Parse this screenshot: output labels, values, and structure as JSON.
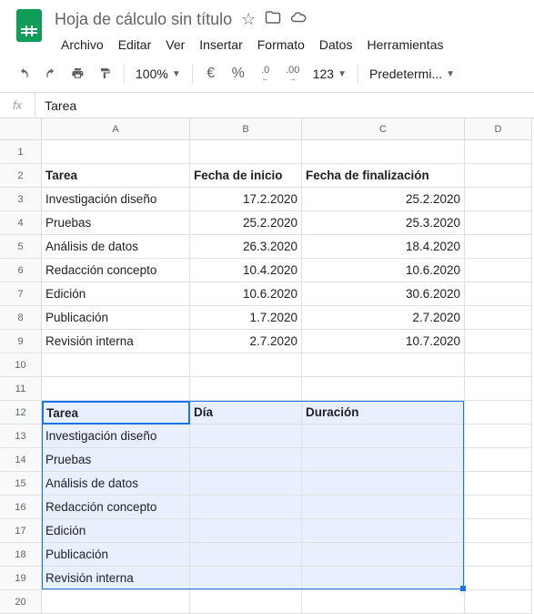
{
  "header": {
    "title": "Hoja de cálculo sin título",
    "menu": [
      "Archivo",
      "Editar",
      "Ver",
      "Insertar",
      "Formato",
      "Datos",
      "Herramientas"
    ]
  },
  "toolbar": {
    "zoom": "100%",
    "currency": "€",
    "percent": "%",
    "dec_dec": ".0",
    "dec_inc": ".00",
    "format": "123",
    "font": "Predetermi..."
  },
  "formula_bar": {
    "fx": "fx",
    "value": "Tarea"
  },
  "columns": [
    "A",
    "B",
    "C",
    "D"
  ],
  "row_count": 20,
  "active_cell": {
    "row": 12,
    "col": "A"
  },
  "selection": {
    "r1": 12,
    "c1": "A",
    "r2": 19,
    "c2": "C"
  },
  "cells": {
    "A2": "Tarea",
    "B2": "Fecha de inicio",
    "C2": "Fecha de finalización",
    "A3": "Investigación diseño",
    "B3": "17.2.2020",
    "C3": "25.2.2020",
    "A4": "Pruebas",
    "B4": "25.2.2020",
    "C4": "25.3.2020",
    "A5": "Análisis de datos",
    "B5": "26.3.2020",
    "C5": "18.4.2020",
    "A6": "Redacción concepto",
    "B6": "10.4.2020",
    "C6": "10.6.2020",
    "A7": "Edición",
    "B7": "10.6.2020",
    "C7": "30.6.2020",
    "A8": "Publicación",
    "B8": "1.7.2020",
    "C8": "2.7.2020",
    "A9": "Revisión interna",
    "B9": "2.7.2020",
    "C9": "10.7.2020",
    "A12": "Tarea",
    "B12": "Día",
    "C12": "Duración",
    "A13": "Investigación diseño",
    "A14": "Pruebas",
    "A15": "Análisis de datos",
    "A16": "Redacción concepto",
    "A17": "Edición",
    "A18": "Publicación",
    "A19": "Revisión interna"
  },
  "bold_cells": [
    "A2",
    "B2",
    "C2",
    "A12",
    "B12",
    "C12"
  ],
  "right_align": [
    "B3",
    "C3",
    "B4",
    "C4",
    "B5",
    "C5",
    "B6",
    "C6",
    "B7",
    "C7",
    "B8",
    "C8",
    "B9",
    "C9"
  ]
}
